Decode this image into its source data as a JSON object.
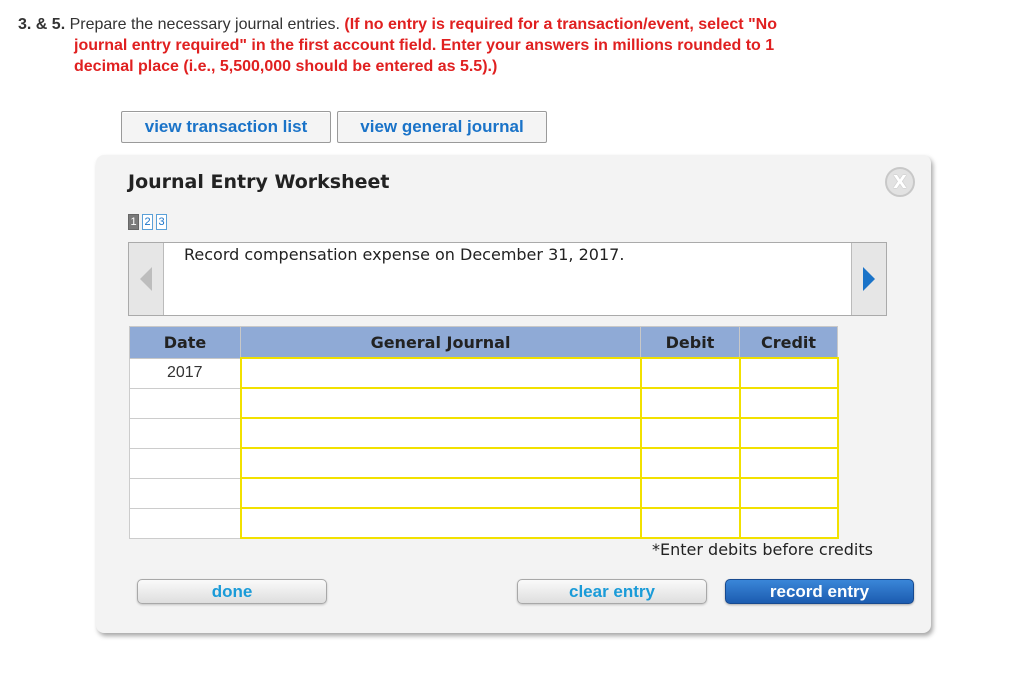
{
  "question": {
    "number": "3. & 5.",
    "text": " Prepare the necessary journal entries. ",
    "instruction_line1": "(If no entry is required for a transaction/event, select \"No",
    "instruction_line2": "journal entry required\" in the first account field. Enter your answers in millions rounded to 1",
    "instruction_line3": "decimal place (i.e., 5,500,000 should be entered as 5.5).)"
  },
  "top_buttons": {
    "view_transactions": "view transaction list",
    "view_journal": "view general journal"
  },
  "worksheet": {
    "title": "Journal Entry Worksheet",
    "close_label": "X",
    "pages": [
      "1",
      "2",
      "3"
    ],
    "current_page": 1,
    "description": "Record compensation expense on December 31, 2017.",
    "columns": [
      "Date",
      "General Journal",
      "Debit",
      "Credit"
    ],
    "rows": [
      {
        "date": "2017",
        "account": "",
        "debit": "",
        "credit": ""
      },
      {
        "date": "",
        "account": "",
        "debit": "",
        "credit": ""
      },
      {
        "date": "",
        "account": "",
        "debit": "",
        "credit": ""
      },
      {
        "date": "",
        "account": "",
        "debit": "",
        "credit": ""
      },
      {
        "date": "",
        "account": "",
        "debit": "",
        "credit": ""
      },
      {
        "date": "",
        "account": "",
        "debit": "",
        "credit": ""
      }
    ],
    "note": "*Enter debits before credits",
    "buttons": {
      "done": "done",
      "clear": "clear entry",
      "record": "record entry"
    }
  },
  "colors": {
    "instruction_red": "#e02020",
    "link_blue": "#1a73c8",
    "header_blue": "#8faad6",
    "input_border_yellow": "#f2e100",
    "record_button_blue": "#2a6fc4"
  }
}
